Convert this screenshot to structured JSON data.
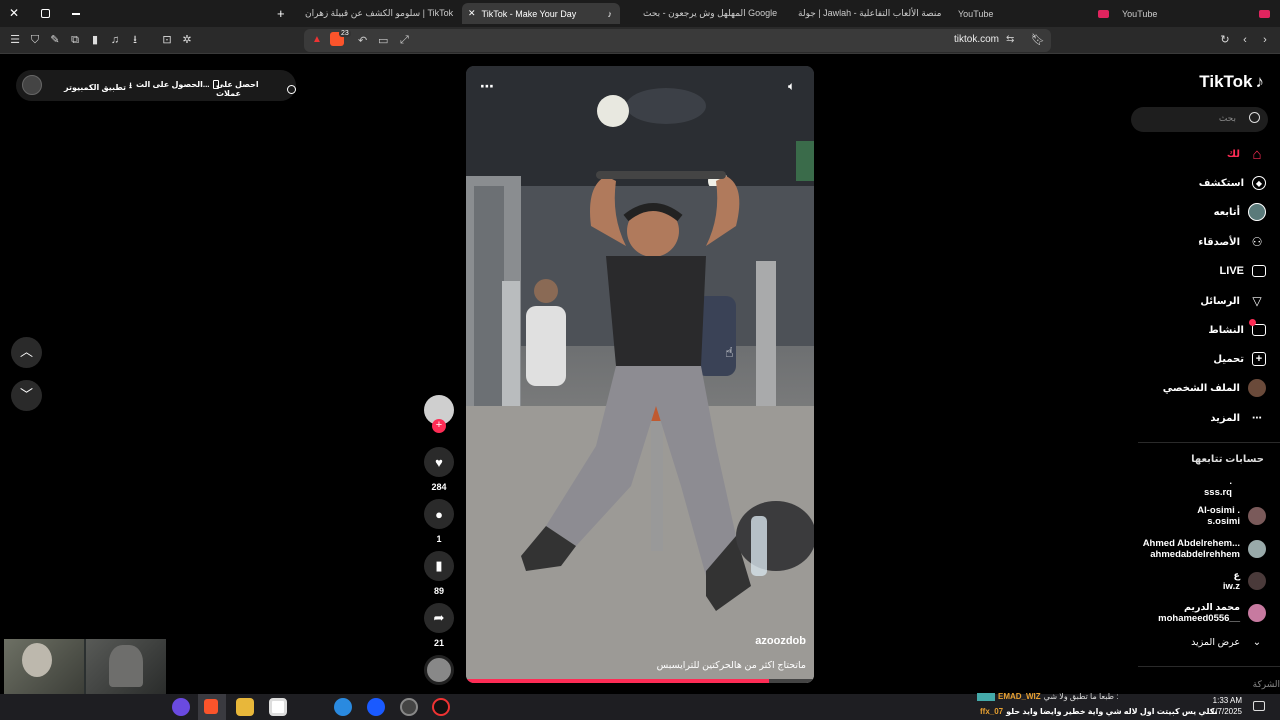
{
  "browser": {
    "tabs": [
      {
        "label": "YouTube",
        "active": false
      },
      {
        "label": "جولة | Jawlah - منصة الألعاب التفاعلية",
        "active": false
      },
      {
        "label": "المهلهل وش يرجعون - بحث Google",
        "active": false
      },
      {
        "label": "TikTok - Make Your Day",
        "active": true
      },
      {
        "label": "سلومو الكشف عن قبيلة زهران | TikTok",
        "active": false
      },
      {
        "label": "YouTube",
        "active": false
      }
    ],
    "url": "tiktok.com",
    "extension_badge": "23"
  },
  "get_bar": {
    "coins": "احصل على عملات",
    "app": "الحصول على الت...",
    "desktop": "تطبيق الكمبيوتر"
  },
  "sidebar": {
    "logo": "TikTok",
    "search_placeholder": "بحث",
    "nav": [
      {
        "label": "لك",
        "icon": "home-icon"
      },
      {
        "label": "استكشف",
        "icon": "compass-icon"
      },
      {
        "label": "أتابعه",
        "icon": "avatar-icon"
      },
      {
        "label": "الأصدقاء",
        "icon": "friends-icon"
      },
      {
        "label": "LIVE",
        "icon": "live-icon"
      },
      {
        "label": "الرسائل",
        "icon": "send-icon"
      },
      {
        "label": "النشاط",
        "icon": "chat-icon"
      },
      {
        "label": "تحميل",
        "icon": "plus-box-icon"
      },
      {
        "label": "الملف الشخصي",
        "icon": "profile-icon"
      },
      {
        "label": "المزيد",
        "icon": "more-icon"
      }
    ],
    "following_title": "حسابات تتابعها",
    "following": [
      {
        "name": ".",
        "handle": "sss.rq"
      },
      {
        "name": "Al-osimi .",
        "handle": "s.osimi"
      },
      {
        "name": "Ahmed Abdelrehem...",
        "handle": "ahmedabdelrehhem"
      },
      {
        "name": "ع",
        "handle": "iw.z"
      },
      {
        "name": "محمد الدريم",
        "handle": "mohameed0556__"
      }
    ],
    "see_more": "عرض المزيد",
    "footer": "الشركة"
  },
  "video": {
    "author": "azoozdob",
    "caption": "ماتحتاج اكثر من هالحركتين للترايسبس",
    "progress": 0.87
  },
  "actions": {
    "likes": "284",
    "comments": "1",
    "saves": "89",
    "shares": "21"
  },
  "taskbar": {
    "time": "1:33 AM",
    "date": "1/7/2025",
    "chat1_user": "EMAD_WIZ",
    "chat1_msg": "طبعا ما تطبق ولا شي :",
    "chat2_user": "ffx_07",
    "chat2_msg": "وشكلي يس كبيتت اول لاله شي واية خطير وايضا وايد حلو :"
  }
}
